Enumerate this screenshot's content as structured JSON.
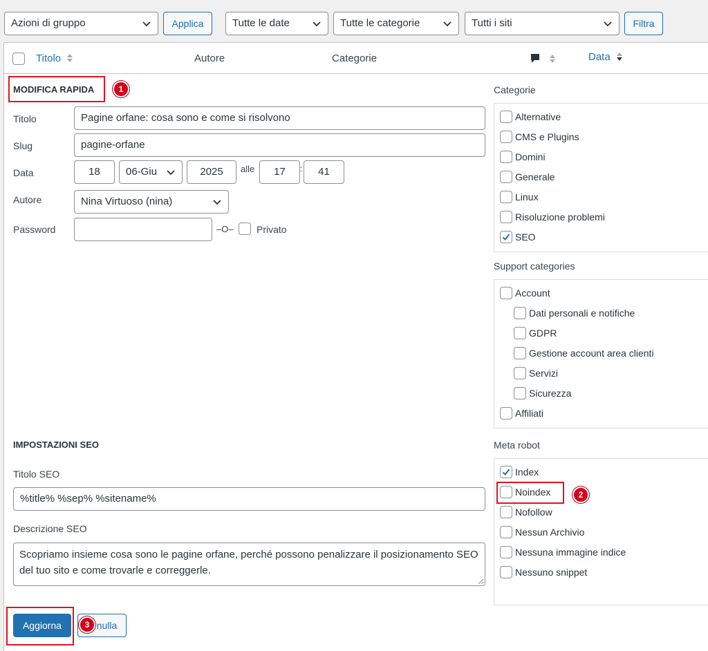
{
  "toolbar": {
    "bulk_actions": "Azioni di gruppo",
    "apply": "Applica",
    "dates": "Tutte le date",
    "categories": "Tutte le categorie",
    "sites": "Tutti i siti",
    "filter": "Filtra"
  },
  "table_header": {
    "title": "Titolo",
    "author": "Autore",
    "categories": "Categorie",
    "date": "Data"
  },
  "quick_edit": {
    "heading": "MODIFICA RAPIDA",
    "title_label": "Titolo",
    "title_value": "Pagine orfane: cosa sono e come si risolvono",
    "slug_label": "Slug",
    "slug_value": "pagine-orfane",
    "date_label": "Data",
    "day": "18",
    "month": "06-Giu",
    "year": "2025",
    "at": "alle",
    "hour": "17",
    "colon": ":",
    "minute": "41",
    "author_label": "Autore",
    "author_value": "Nina Virtuoso (nina)",
    "password_label": "Password",
    "password_value": "",
    "or": "–O–",
    "private": "Privato"
  },
  "categories_box": {
    "heading": "Categorie",
    "items": [
      {
        "label": "Alternative",
        "checked": false
      },
      {
        "label": "CMS e Plugins",
        "checked": false
      },
      {
        "label": "Domini",
        "checked": false
      },
      {
        "label": "Generale",
        "checked": false
      },
      {
        "label": "Linux",
        "checked": false
      },
      {
        "label": "Risoluzione problemi",
        "checked": false
      },
      {
        "label": "SEO",
        "checked": true
      }
    ]
  },
  "support_box": {
    "heading": "Support categories",
    "items": [
      {
        "label": "Account",
        "checked": false
      },
      {
        "label": "Dati personali e notifiche",
        "checked": false
      },
      {
        "label": "GDPR",
        "checked": false
      },
      {
        "label": "Gestione account area clienti",
        "checked": false
      },
      {
        "label": "Servizi",
        "checked": false
      },
      {
        "label": "Sicurezza",
        "checked": false
      },
      {
        "label": "Affiliati",
        "checked": false
      }
    ]
  },
  "seo": {
    "heading": "IMPOSTAZIONI SEO",
    "title_label": "Titolo SEO",
    "title_value": "%title% %sep% %sitename%",
    "desc_label": "Descrizione SEO",
    "desc_value": "Scopriamo insieme cosa sono le pagine orfane, perché possono penalizzare il posizionamento SEO del tuo sito e come trovarle e correggerle."
  },
  "meta_robot": {
    "heading": "Meta robot",
    "items": [
      {
        "label": "Index",
        "checked": true
      },
      {
        "label": "Noindex",
        "checked": false
      },
      {
        "label": "Nofollow",
        "checked": false
      },
      {
        "label": "Nessun Archivio",
        "checked": false
      },
      {
        "label": "Nessuna immagine indice",
        "checked": false
      },
      {
        "label": "Nessuno snippet",
        "checked": false
      }
    ]
  },
  "actions": {
    "update": "Aggiorna",
    "cancel": "Annulla",
    "cancel_visible": "nulla"
  },
  "badges": {
    "one": "1",
    "two": "2",
    "three": "3"
  },
  "colors": {
    "accent": "#2271b1",
    "highlight": "#e3111f"
  }
}
